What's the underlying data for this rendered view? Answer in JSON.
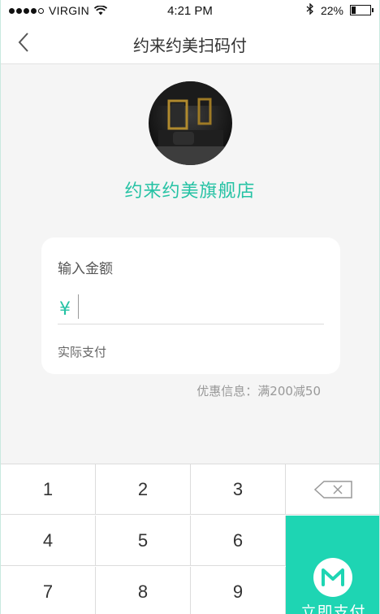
{
  "status_bar": {
    "carrier": "VIRGIN",
    "time": "4:21 PM",
    "battery": "22%"
  },
  "nav": {
    "title": "约来约美扫码付"
  },
  "store": {
    "name": "约来约美旗舰店"
  },
  "payment": {
    "amount_label": "输入金额",
    "currency_symbol": "¥",
    "amount_value": "",
    "actual_pay_label": "实际支付",
    "discount_info": "优惠信息：满200减50"
  },
  "keypad": {
    "keys": [
      "1",
      "2",
      "3",
      "4",
      "5",
      "6",
      "7",
      "8",
      "9"
    ],
    "pay_label": "立即支付"
  },
  "colors": {
    "accent": "#25c2a4",
    "pay_button": "#1ed5b3"
  }
}
